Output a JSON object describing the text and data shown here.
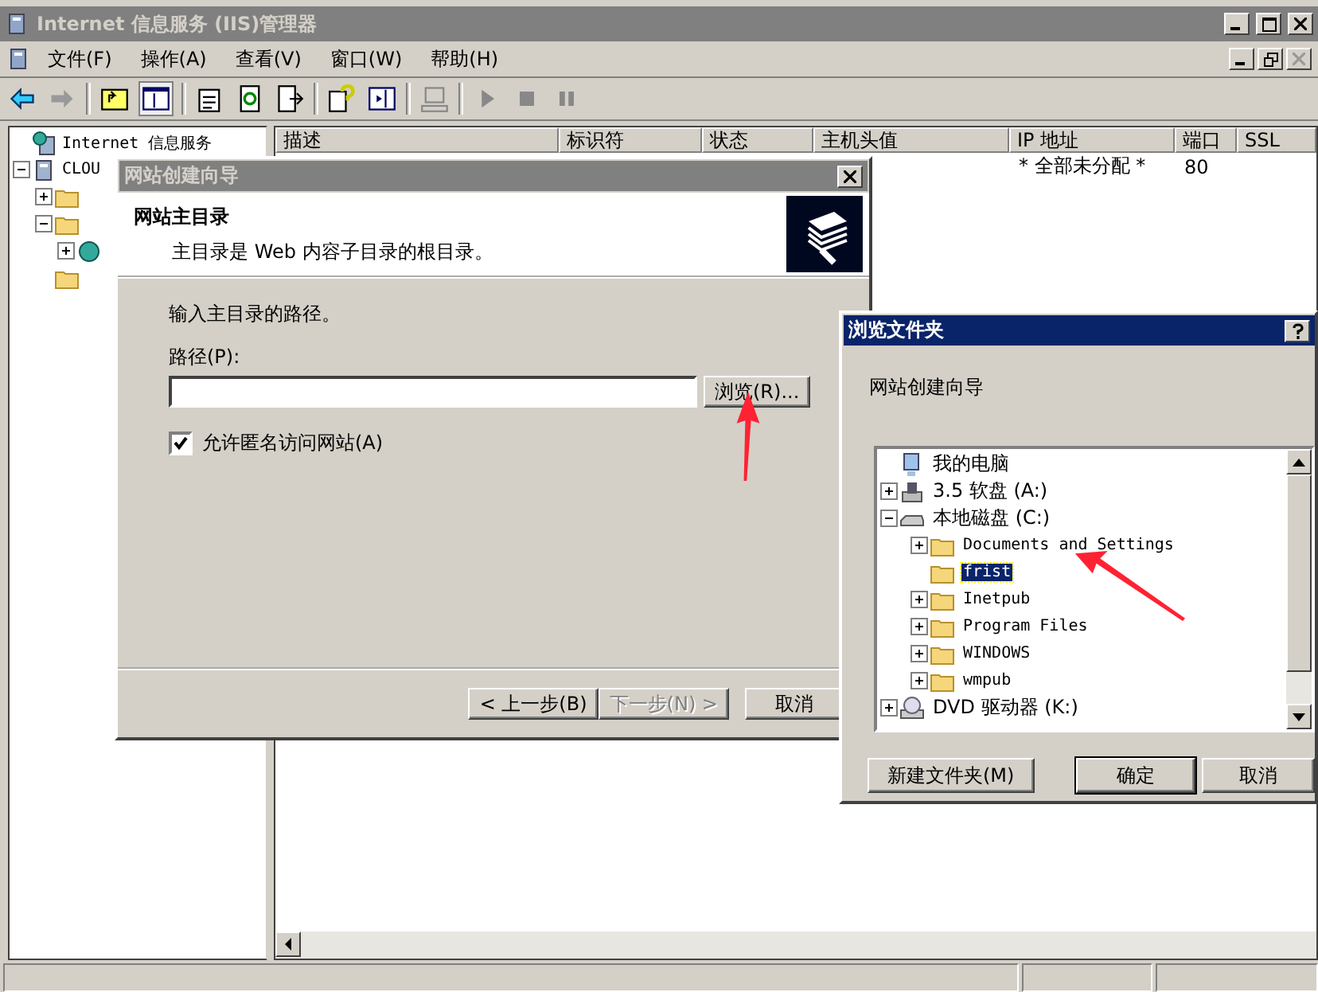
{
  "window": {
    "title": "Internet 信息服务 (IIS)管理器"
  },
  "menu": [
    "文件(F)",
    "操作(A)",
    "查看(V)",
    "窗口(W)",
    "帮助(H)"
  ],
  "tree": [
    {
      "label": "Internet 信息服务",
      "kind": "iis",
      "children": [
        {
          "label": "CLOU",
          "kind": "server",
          "expanded": true,
          "children": [
            {
              "kind": "folder",
              "expanded": false
            },
            {
              "kind": "folder",
              "expanded": true,
              "children": [
                {
                  "kind": "globe",
                  "expanded": false
                }
              ]
            },
            {
              "kind": "folder"
            }
          ]
        }
      ]
    }
  ],
  "table": {
    "columns": [
      "描述",
      "标识符",
      "状态",
      "主机头值",
      "IP 地址",
      "端口",
      "SSL"
    ],
    "rows": [
      {
        "ip": "* 全部未分配 *",
        "port": "80"
      }
    ]
  },
  "wizard": {
    "title": "网站创建向导",
    "heading": "网站主目录",
    "subheading": "主目录是 Web 内容子目录的根目录。",
    "prompt": "输入主目录的路径。",
    "path_label": "路径(P):",
    "browse_button": "浏览(R)...",
    "anonymous": {
      "label": "允许匿名访问网站(A)",
      "checked": true
    },
    "buttons": [
      {
        "label": "< 上一步(B)",
        "disabled": false
      },
      {
        "label": "下一步(N) >",
        "disabled": true
      },
      {
        "label": "取消",
        "disabled": false
      }
    ]
  },
  "browse": {
    "title": "浏览文件夹",
    "description": "网站创建向导",
    "tree": [
      {
        "label": "我的电脑",
        "kind": "computer",
        "selected": false,
        "children": [
          {
            "label": "3.5 软盘 (A:)",
            "kind": "floppy",
            "expanded": false,
            "selected": false
          },
          {
            "label": "本地磁盘 (C:)",
            "kind": "disk",
            "expanded": true,
            "selected": false,
            "children": [
              {
                "label": "Documents and Settings",
                "kind": "folder",
                "expanded": false,
                "selected": false
              },
              {
                "label": "frist",
                "kind": "folder",
                "selected": true
              },
              {
                "label": "Inetpub",
                "kind": "folder",
                "expanded": false,
                "selected": false
              },
              {
                "label": "Program Files",
                "kind": "folder",
                "expanded": false,
                "selected": false
              },
              {
                "label": "WINDOWS",
                "kind": "folder",
                "expanded": false,
                "selected": false
              },
              {
                "label": "wmpub",
                "kind": "folder",
                "expanded": false,
                "selected": false
              }
            ]
          },
          {
            "label": "DVD 驱动器 (K:)",
            "kind": "dvd",
            "expanded": false,
            "selected": false
          }
        ]
      }
    ],
    "buttons": [
      {
        "label": "新建文件夹(M)",
        "default": false
      },
      {
        "label": "确定",
        "default": true
      },
      {
        "label": "取消",
        "default": false
      }
    ]
  }
}
